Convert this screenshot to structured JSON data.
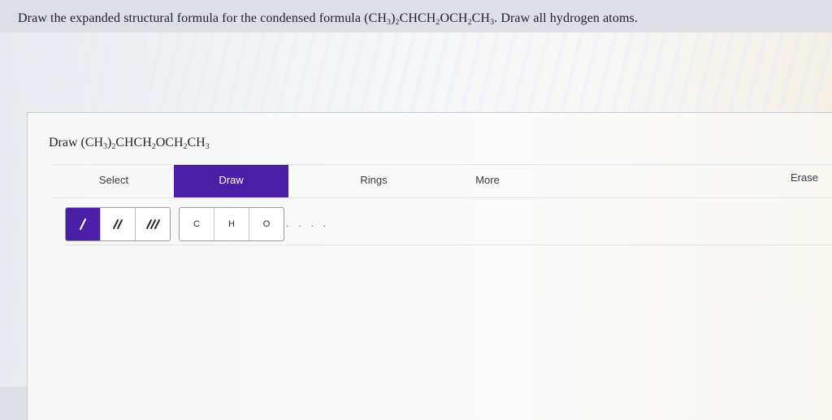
{
  "question": {
    "lead": "Draw the expanded structural formula for the condensed formula (CH",
    "s1": "3",
    "p1": ")",
    "s2": "2",
    "p2": "CHCH",
    "s3": "2",
    "p3": "OCH",
    "s4": "2",
    "p4": "CH",
    "s5": "3",
    "tail": ". Draw all hydrogen atoms."
  },
  "panel": {
    "title": {
      "lead": "Draw (CH",
      "s1": "3",
      "p1": ")",
      "s2": "2",
      "p2": "CHCH",
      "s3": "2",
      "p3": "OCH",
      "s4": "2",
      "p4": "CH",
      "s5": "3"
    },
    "tabs": {
      "select": "Select",
      "draw": "Draw",
      "rings": "Rings",
      "more": "More",
      "erase": "Erase"
    },
    "active_tab": "Draw",
    "bond_tools": [
      {
        "icon": "single-bond-icon",
        "active": true
      },
      {
        "icon": "double-bond-icon",
        "active": false
      },
      {
        "icon": "triple-bond-icon",
        "active": false
      }
    ],
    "atom_tools": [
      "C",
      "H",
      "O"
    ],
    "more_indicator": ". . . ."
  },
  "colors": {
    "accent": "#4a1fa6",
    "background": "#dedfe4",
    "panel": "#f7f7f8"
  }
}
